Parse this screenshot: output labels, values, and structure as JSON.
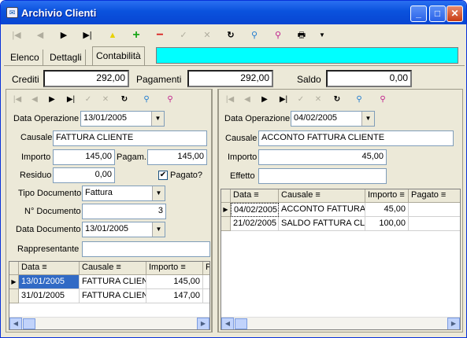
{
  "window": {
    "title": "Archivio Clienti"
  },
  "toolbar": {
    "icons": [
      "first-record-icon",
      "prev-record-icon",
      "next-record-icon",
      "last-record-icon",
      "insert-icon",
      "add-icon",
      "delete-icon",
      "confirm-icon",
      "cancel-icon",
      "refresh-icon",
      "search-icon",
      "filter-icon",
      "print-icon",
      "dropdown-icon"
    ]
  },
  "tabs": [
    {
      "label": "Elenco"
    },
    {
      "label": "Dettagli"
    },
    {
      "label": "Contabilità"
    }
  ],
  "summary": {
    "crediti_label": "Crediti",
    "crediti_value": "292,00",
    "pagamenti_label": "Pagamenti",
    "pagamenti_value": "292,00",
    "saldo_label": "Saldo",
    "saldo_value": "0,00"
  },
  "left": {
    "data_operazione_label": "Data Operazione",
    "data_operazione": "13/01/2005",
    "causale_label": "Causale",
    "causale": "FATTURA CLIENTE",
    "importo_label": "Importo",
    "importo": "145,00",
    "pagam_label": "Pagam.",
    "pagam": "145,00",
    "residuo_label": "Residuo",
    "residuo": "0,00",
    "pagato_label": "Pagato?",
    "pagato_checked": true,
    "tipo_documento_label": "Tipo Documento",
    "tipo_documento": "Fattura",
    "num_documento_label": "N° Documento",
    "num_documento": "3",
    "data_documento_label": "Data Documento",
    "data_documento": "13/01/2005",
    "rappresentante_label": "Rappresentante",
    "rappresentante": "",
    "grid": {
      "columns": [
        "Data",
        "Causale",
        "Importo",
        "Pa"
      ],
      "rows": [
        {
          "data": "13/01/2005",
          "causale": "FATTURA CLIENT",
          "importo": "145,00",
          "selected": true
        },
        {
          "data": "31/01/2005",
          "causale": "FATTURA CLIENT",
          "importo": "147,00",
          "selected": false
        }
      ]
    }
  },
  "right": {
    "data_operazione_label": "Data Operazione",
    "data_operazione": "04/02/2005",
    "causale_label": "Causale",
    "causale": "ACCONTO FATTURA CLIENTE",
    "importo_label": "Importo",
    "importo": "45,00",
    "effetto_label": "Effetto",
    "effetto": "",
    "grid": {
      "columns": [
        "Data",
        "Causale",
        "Importo",
        "Pagato"
      ],
      "rows": [
        {
          "data": "04/02/2005",
          "causale": "ACCONTO FATTURA",
          "importo": "45,00",
          "selected": true
        },
        {
          "data": "21/02/2005",
          "causale": "SALDO FATTURA CLI",
          "importo": "100,00",
          "selected": false
        }
      ]
    }
  }
}
